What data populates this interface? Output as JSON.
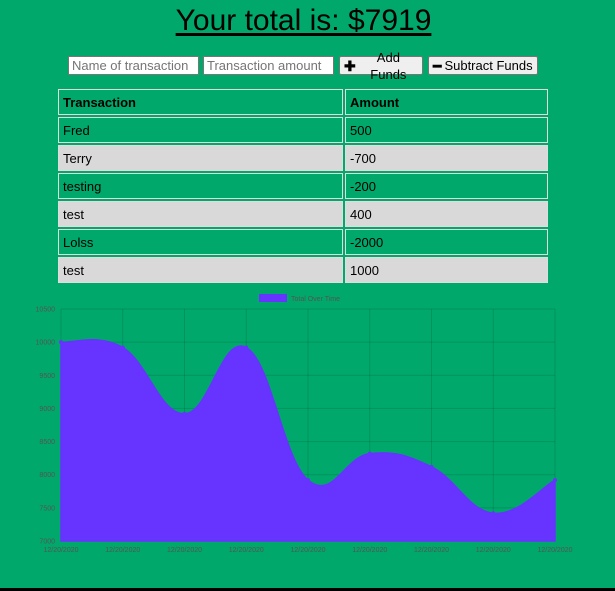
{
  "header": {
    "total_text": "Your total is: $7919"
  },
  "form": {
    "name_placeholder": "Name of transaction",
    "amount_placeholder": "Transaction amount",
    "add_icon": "plus-icon",
    "add_label": "Add Funds",
    "subtract_icon": "minus-icon",
    "subtract_label": "Subtract Funds"
  },
  "table": {
    "headers": [
      "Transaction",
      "Amount"
    ],
    "rows": [
      {
        "name": "Fred",
        "amount": "500"
      },
      {
        "name": "Terry",
        "amount": "-700"
      },
      {
        "name": "testing",
        "amount": "-200"
      },
      {
        "name": "test",
        "amount": "400"
      },
      {
        "name": "Lolss",
        "amount": "-2000"
      },
      {
        "name": "test",
        "amount": "1000"
      }
    ]
  },
  "colors": {
    "background": "#00a86b",
    "row_alt": "#d9d9d9",
    "series_fill": "#6633ff"
  },
  "chart_data": {
    "type": "area",
    "title": "",
    "xlabel": "",
    "ylabel": "",
    "legend": "top-center",
    "grid": true,
    "ylim": [
      7000,
      10500
    ],
    "yticks": [
      7000,
      7500,
      8000,
      8500,
      9000,
      9500,
      10000,
      10500
    ],
    "x": [
      "12/20/2020",
      "12/20/2020",
      "12/20/2020",
      "12/20/2020",
      "12/20/2020",
      "12/20/2020",
      "12/20/2020",
      "12/20/2020",
      "12/20/2020"
    ],
    "series": [
      {
        "name": "Total Over Time",
        "values": [
          10000,
          9919,
          8919,
          9919,
          7919,
          8319,
          8119,
          7419,
          7919
        ]
      }
    ]
  }
}
